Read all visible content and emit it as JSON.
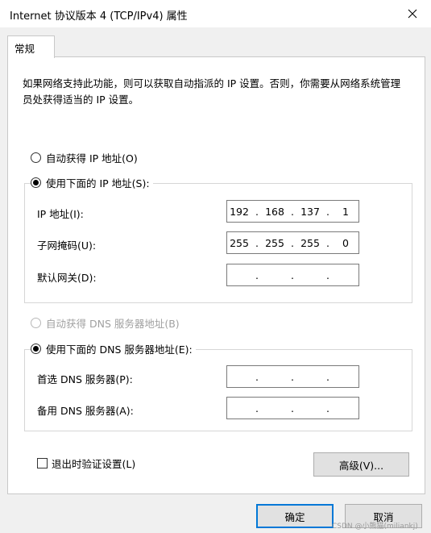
{
  "window": {
    "title": "Internet 协议版本 4 (TCP/IPv4) 属性"
  },
  "tabs": [
    {
      "label": "常规"
    }
  ],
  "description": "如果网络支持此功能，则可以获取自动指派的 IP 设置。否则，你需要从网络系统管理员处获得适当的 IP 设置。",
  "ip_section": {
    "auto_label": "自动获得 IP 地址(O)",
    "manual_label": "使用下面的 IP 地址(S):",
    "selected": "manual",
    "fields": [
      {
        "label": "IP 地址(I):",
        "octets": [
          "192",
          "168",
          "137",
          "1"
        ]
      },
      {
        "label": "子网掩码(U):",
        "octets": [
          "255",
          "255",
          "255",
          "0"
        ]
      },
      {
        "label": "默认网关(D):",
        "octets": [
          "",
          "",
          "",
          ""
        ]
      }
    ]
  },
  "dns_section": {
    "auto_label": "自动获得 DNS 服务器地址(B)",
    "manual_label": "使用下面的 DNS 服务器地址(E):",
    "selected": "manual",
    "fields": [
      {
        "label": "首选 DNS 服务器(P):",
        "octets": [
          "",
          "",
          "",
          ""
        ]
      },
      {
        "label": "备用 DNS 服务器(A):",
        "octets": [
          "",
          "",
          "",
          ""
        ]
      }
    ]
  },
  "validate_on_exit": {
    "label": "退出时验证设置(L)",
    "checked": false
  },
  "buttons": {
    "advanced": "高级(V)...",
    "ok": "确定",
    "cancel": "取消"
  },
  "watermark": "CSDN @小熊猫(miliankj)",
  "colors": {
    "default_button_border": "#0078d7",
    "disabled_text": "#a0a0a0"
  }
}
